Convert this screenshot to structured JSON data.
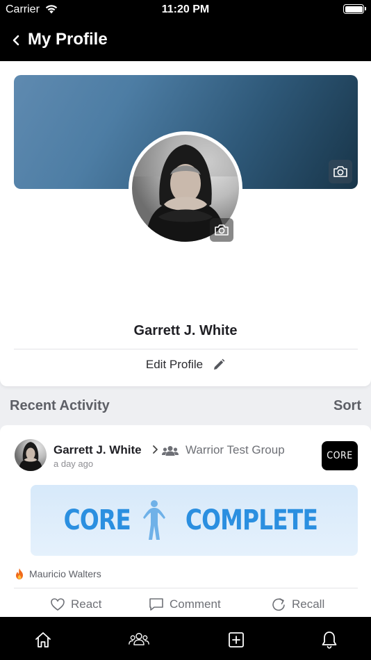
{
  "status_bar": {
    "carrier": "Carrier",
    "time": "11:20 PM"
  },
  "header": {
    "title": "My Profile"
  },
  "profile": {
    "name": "Garrett J. White",
    "edit_label": "Edit Profile"
  },
  "recent_activity": {
    "title": "Recent Activity",
    "sort_label": "Sort"
  },
  "post": {
    "author": "Garrett J. White",
    "group": "Warrior Test Group",
    "time_ago": "a day ago",
    "group_badge": "CORE",
    "banner_left": "CORE",
    "banner_right": "COMPLETE",
    "reactor": "Mauricio Walters",
    "actions": {
      "react": "React",
      "comment": "Comment",
      "recall": "Recall"
    }
  },
  "colors": {
    "accent_blue": "#2b8fe0",
    "bar_black": "#000000"
  },
  "icons": [
    "wifi-icon",
    "battery-icon",
    "back-chevron-icon",
    "camera-icon",
    "pencil-icon",
    "group-icon",
    "fire-icon",
    "heart-icon",
    "comment-icon",
    "recall-icon",
    "home-icon",
    "people-icon",
    "add-post-icon",
    "bell-icon"
  ]
}
